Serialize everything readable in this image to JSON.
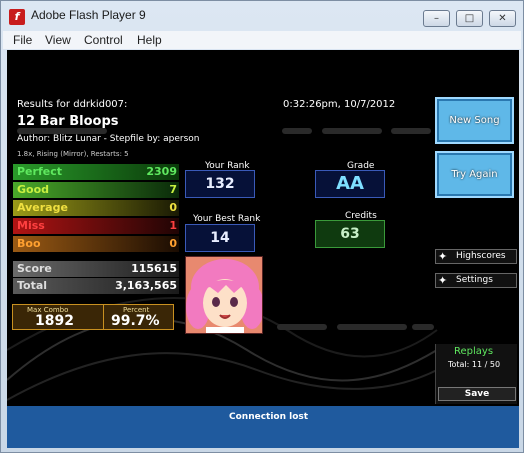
{
  "window": {
    "title": "Adobe Flash Player 9"
  },
  "window_controls": {
    "minimize": "–",
    "restore": "□",
    "close": "✕"
  },
  "menu": {
    "items": [
      "File",
      "View",
      "Control",
      "Help"
    ]
  },
  "results": {
    "header": "Results for ddrkid007:",
    "timestamp": "0:32:26pm, 10/7/2012",
    "song_title": "12 Bar Bloops",
    "author_line": "Author: Blitz Lunar  -  Stepfile by: aperson",
    "mods_line": "1.8x, Rising (Mirror), Restarts: 5"
  },
  "judgements": [
    {
      "label": "Perfect",
      "value": "2309",
      "color": "#1f8a1f",
      "text": "#5fe85f"
    },
    {
      "label": "Good",
      "value": "7",
      "color": "#3a9a1a",
      "text": "#c8f040"
    },
    {
      "label": "Average",
      "value": "0",
      "color": "#8a8a10",
      "text": "#f0e040"
    },
    {
      "label": "Miss",
      "value": "1",
      "color": "#a01010",
      "text": "#ff4040"
    },
    {
      "label": "Boo",
      "value": "0",
      "color": "#8a4a10",
      "text": "#ffa030"
    }
  ],
  "score": {
    "label": "Score",
    "value": "115615"
  },
  "total": {
    "label": "Total",
    "value": "3,163,565"
  },
  "max_combo": {
    "label": "Max Combo",
    "value": "1892"
  },
  "percent": {
    "label": "Percent",
    "value": "99.7%"
  },
  "your_rank": {
    "label": "Your Rank",
    "value": "132"
  },
  "grade": {
    "label": "Grade",
    "value": "AA"
  },
  "best_rank": {
    "label": "Your Best Rank",
    "value": "14"
  },
  "credits": {
    "label": "Credits",
    "value": "63"
  },
  "buttons": {
    "new_song": "New Song",
    "try_again": "Try Again",
    "highscores": "Highscores",
    "settings": "Settings",
    "save": "Save"
  },
  "replays": {
    "label": "Replays",
    "total": "Total: 11 / 50"
  },
  "status": {
    "text": "Connection lost"
  }
}
